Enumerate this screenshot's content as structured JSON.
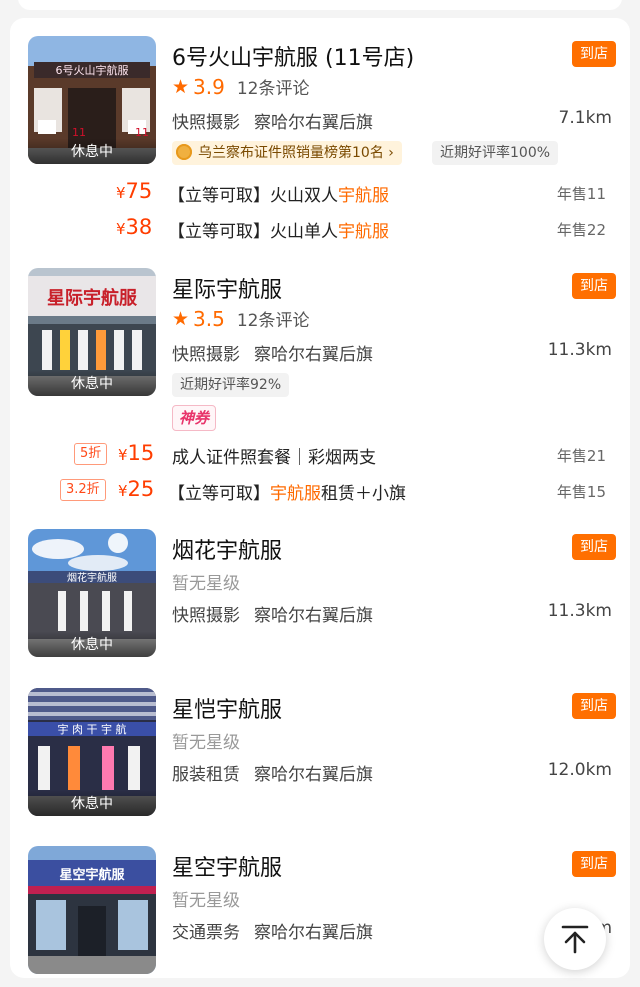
{
  "status_label": "休息中",
  "action_label": "到店",
  "colors": {
    "accent": "#ff6f00",
    "price": "#ff3d00",
    "star": "#ff6a00",
    "shenquan": "#e8336a"
  },
  "shops": [
    {
      "name": "6号火山宇航服 (11号店)",
      "star_icon": "★",
      "score": "3.9",
      "reviews": "12条评论",
      "category": "快照摄影",
      "area": "察哈尔右翼后旗",
      "distance": "7.1km",
      "rank_badge": "乌兰察布证件照销量榜第10名",
      "rank_arrow": "›",
      "good_rate": "近期好评率100%",
      "sign_text": "6号火山宇航服",
      "sign_number": "11",
      "deals": [
        {
          "currency": "¥",
          "price": "75",
          "title_prefix": "【立等可取】火山双人",
          "title_highlight": "宇航服",
          "title_suffix": "",
          "sold": "年售11"
        },
        {
          "currency": "¥",
          "price": "38",
          "title_prefix": "【立等可取】火山单人",
          "title_highlight": "宇航服",
          "title_suffix": "",
          "sold": "年售22"
        }
      ]
    },
    {
      "name": "星际宇航服",
      "star_icon": "★",
      "score": "3.5",
      "reviews": "12条评论",
      "category": "快照摄影",
      "area": "察哈尔右翼后旗",
      "distance": "11.3km",
      "good_rate": "近期好评率92%",
      "coupon_label": "神券",
      "sign_text": "星际宇航服",
      "deals": [
        {
          "discount": "5折",
          "currency": "¥",
          "price": "15",
          "title_prefix": "成人证件照套餐｜彩烟两支",
          "title_highlight": "",
          "title_suffix": "",
          "sold": "年售21"
        },
        {
          "discount": "3.2折",
          "currency": "¥",
          "price": "25",
          "title_prefix": "【立等可取】",
          "title_highlight": "宇航服",
          "title_suffix": "租赁＋小旗",
          "sold": "年售15"
        }
      ]
    },
    {
      "name": "烟花宇航服",
      "no_rating": "暂无星级",
      "category": "快照摄影",
      "area": "察哈尔右翼后旗",
      "distance": "11.3km",
      "sign_text": "烟花宇航服"
    },
    {
      "name": "星恺宇航服",
      "no_rating": "暂无星级",
      "category": "服装租赁",
      "area": "察哈尔右翼后旗",
      "distance": "12.0km",
      "sign_text": "宇 肉 干 宇 航"
    },
    {
      "name": "星空宇航服",
      "no_rating": "暂无星级",
      "category": "交通票务",
      "area": "察哈尔右翼后旗",
      "distance": "m",
      "sign_text": "星空宇航服"
    }
  ],
  "back_to_top_icon": "arrow-up-to-top"
}
